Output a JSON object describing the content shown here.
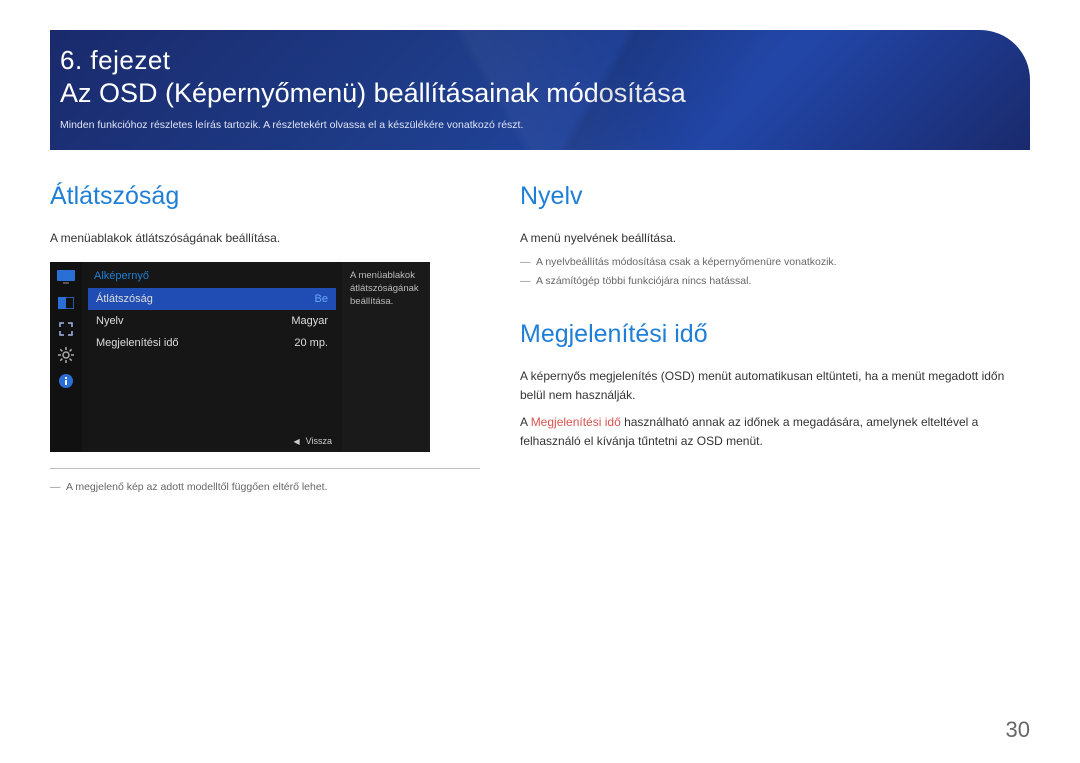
{
  "banner": {
    "chapter": "6. fejezet",
    "title": "Az OSD (Képernyőmenü) beállításainak módosítása",
    "sub": "Minden funkcióhoz részletes leírás tartozik. A részletekért olvassa el a készülékére vonatkozó részt."
  },
  "left": {
    "heading": "Átlátszóság",
    "p1": "A menüablakok átlátszóságának beállítása.",
    "footnote": "A megjelenő kép az adott modelltől függően eltérő lehet."
  },
  "osd": {
    "title": "Alképernyő",
    "rows": [
      {
        "label": "Átlátszóság",
        "value": "Be",
        "selected": true
      },
      {
        "label": "Nyelv",
        "value": "Magyar",
        "selected": false
      },
      {
        "label": "Megjelenítési idő",
        "value": "20 mp.",
        "selected": false
      }
    ],
    "side": "A menüablakok átlátszóságának beállítása.",
    "back": "Vissza",
    "icons": [
      "monitor-icon",
      "window-icon",
      "resize-icon",
      "gear-icon",
      "info-icon"
    ]
  },
  "right": {
    "sec1": {
      "heading": "Nyelv",
      "p": "A menü nyelvének beállítása.",
      "notes": [
        "A nyelvbeállítás módosítása csak a képernyőmenüre vonatkozik.",
        "A számítógép többi funkciójára nincs hatással."
      ]
    },
    "sec2": {
      "heading": "Megjelenítési idő",
      "p1": "A képernyős megjelenítés (OSD) menüt automatikusan eltünteti, ha a menüt megadott időn belül nem használják.",
      "p2_pre": "A ",
      "p2_accent": "Megjelenítési idő",
      "p2_post": " használható annak az időnek a megadására, amelynek elteltével a felhasználó el kívánja tűntetni az OSD menüt."
    }
  },
  "page_number": "30"
}
